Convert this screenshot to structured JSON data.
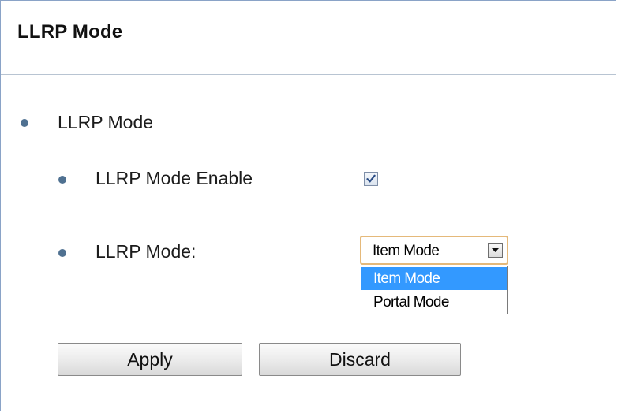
{
  "panel": {
    "title": "LLRP Mode"
  },
  "section": {
    "heading": "LLRP Mode",
    "enable_label": "LLRP Mode Enable",
    "enable_checked": true,
    "mode_label": "LLRP Mode:"
  },
  "mode_select": {
    "value": "Item Mode",
    "options": [
      "Item Mode",
      "Portal Mode"
    ],
    "highlighted_option": "Item Mode"
  },
  "buttons": {
    "apply_label": "Apply",
    "discard_label": "Discard"
  },
  "icons": {
    "bullet": "bullet-dot-icon",
    "check": "checkmark-icon",
    "dropdown_arrow": "triangle-down-icon"
  },
  "colors": {
    "bullet": "#4f7191",
    "highlight": "#3399ff",
    "select_focus_border": "#e5b97a",
    "panel_border": "#8aa3c7"
  }
}
